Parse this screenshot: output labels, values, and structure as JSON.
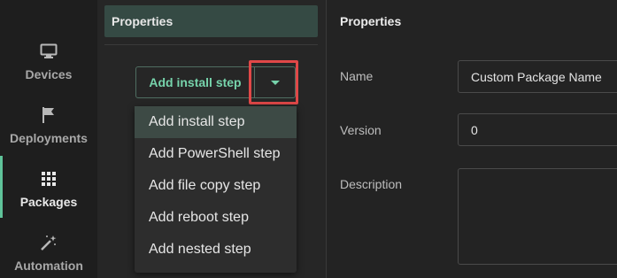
{
  "sidebar": {
    "items": [
      {
        "label": "Devices",
        "icon": "monitor-icon"
      },
      {
        "label": "Deployments",
        "icon": "flag-icon"
      },
      {
        "label": "Packages",
        "icon": "grid-icon",
        "active": true
      },
      {
        "label": "Automation",
        "icon": "magic-wand-icon"
      }
    ]
  },
  "left_panel": {
    "header": "Properties",
    "split_button": {
      "label": "Add install step"
    },
    "dropdown": {
      "items": [
        "Add install step",
        "Add PowerShell step",
        "Add file copy step",
        "Add reboot step",
        "Add nested step"
      ]
    }
  },
  "properties": {
    "title": "Properties",
    "name_label": "Name",
    "name_value": "Custom Package Name",
    "version_label": "Version",
    "version_value": "0",
    "description_label": "Description",
    "description_value": ""
  },
  "colors": {
    "accent": "#5fc39a",
    "accent_text": "#76d3ab",
    "highlight": "#e04848",
    "header_bg": "#354a44"
  }
}
